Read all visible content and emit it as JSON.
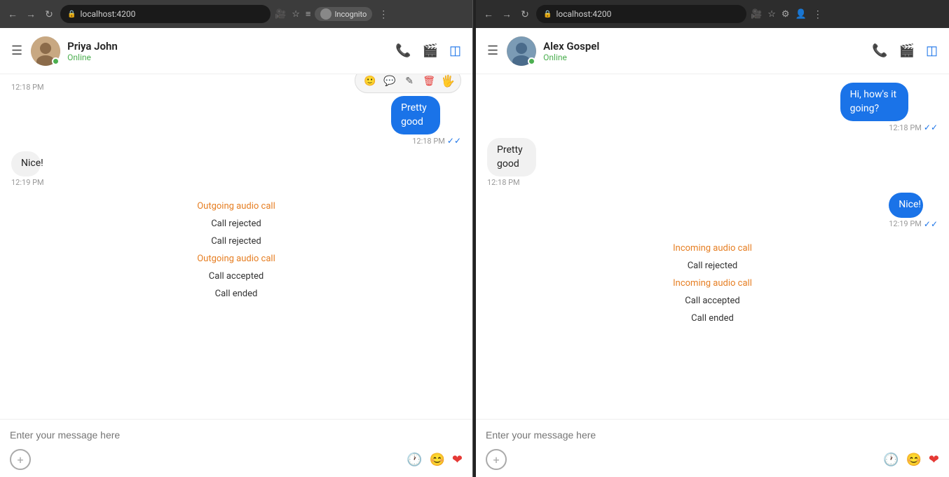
{
  "left_browser": {
    "url": "localhost:4200",
    "mode": "Incognito",
    "contact": {
      "name": "Priya John",
      "status": "Online"
    },
    "messages": [
      {
        "id": "msg1",
        "type": "received",
        "time": "12:18 PM",
        "text": ""
      },
      {
        "id": "msg2",
        "type": "sent",
        "text": "Pretty good",
        "time": "12:18 PM",
        "hasActions": true
      },
      {
        "id": "msg3",
        "type": "received",
        "text": "Nice!",
        "time": "12:19 PM"
      }
    ],
    "calls": [
      {
        "id": "c1",
        "text": "Outgoing audio call",
        "type": "outgoing"
      },
      {
        "id": "c2",
        "text": "Call rejected",
        "type": "rejected"
      },
      {
        "id": "c3",
        "text": "Call rejected",
        "type": "rejected"
      },
      {
        "id": "c4",
        "text": "Outgoing audio call",
        "type": "outgoing"
      },
      {
        "id": "c5",
        "text": "Call accepted",
        "type": "accepted"
      },
      {
        "id": "c6",
        "text": "Call ended",
        "type": "ended"
      }
    ],
    "input_placeholder": "Enter your message here"
  },
  "right_browser": {
    "url": "localhost:4200",
    "contact": {
      "name": "Alex Gospel",
      "status": "Online"
    },
    "messages": [
      {
        "id": "msg1",
        "type": "sent",
        "text": "Hi, how's it going?",
        "time": "12:18 PM"
      },
      {
        "id": "msg2",
        "type": "received",
        "text": "Pretty good",
        "time": "12:18 PM"
      },
      {
        "id": "msg3",
        "type": "sent",
        "text": "Nice!",
        "time": "12:19 PM"
      }
    ],
    "calls": [
      {
        "id": "c1",
        "text": "Incoming audio call",
        "type": "incoming"
      },
      {
        "id": "c2",
        "text": "Call rejected",
        "type": "rejected"
      },
      {
        "id": "c3",
        "text": "Incoming audio call",
        "type": "incoming"
      },
      {
        "id": "c4",
        "text": "Call accepted",
        "type": "accepted"
      },
      {
        "id": "c5",
        "text": "Call ended",
        "type": "ended"
      }
    ],
    "input_placeholder": "Enter your message here"
  },
  "actions": {
    "emoji": "😊",
    "comment": "💬",
    "edit": "✏️",
    "trash": "🗑️"
  }
}
